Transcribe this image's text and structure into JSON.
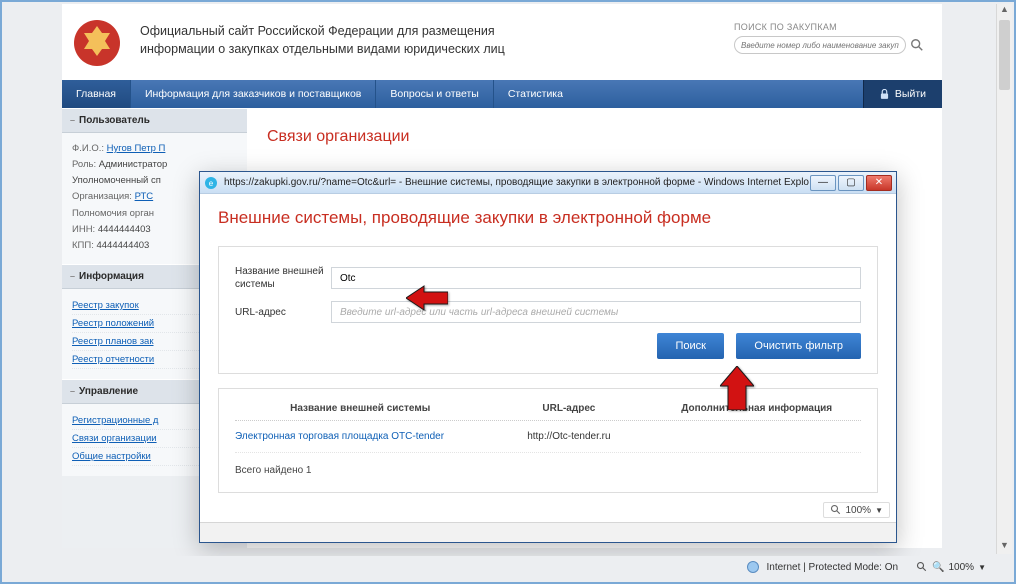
{
  "site": {
    "title_line1": "Официальный сайт Российской Федерации для размещения",
    "title_line2": "информации о закупках отдельными видами юридических лиц",
    "search_label": "ПОИСК ПО ЗАКУПКАМ",
    "search_placeholder": "Введите номер либо наименование закупки"
  },
  "nav": {
    "items": [
      "Главная",
      "Информация для заказчиков и поставщиков",
      "Вопросы и ответы",
      "Статистика"
    ],
    "login": "Выйти"
  },
  "sidebar": {
    "user_head": "Пользователь",
    "fio_label": "Ф.И.О.:",
    "fio_value": "Нугов Петр П",
    "role_label": "Роль:",
    "role_value": "Администратор Уполномоченный сп",
    "org_label": "Организация:",
    "org_value": "РТС",
    "perm_label": "Полномочия орган",
    "inn_label": "ИНН:",
    "inn_value": "4444444403",
    "kpp_label": "КПП:",
    "kpp_value": "4444444403",
    "info_head": "Информация",
    "info_links": [
      "Реестр закупок",
      "Реестр положений",
      "Реестр планов зак",
      "Реестр отчетности"
    ],
    "manage_head": "Управление",
    "manage_links": [
      "Регистрационные д",
      "Связи организации",
      "Общие настройки"
    ]
  },
  "content": {
    "heading": "Связи организации"
  },
  "modal": {
    "window_title": "https://zakupki.gov.ru/?name=Otc&url= - Внешние системы, проводящие закупки в электронной форме - Windows Internet Explo",
    "heading": "Внешние системы, проводящие закупки в электронной форме",
    "name_label": "Название внешней\nсистемы",
    "name_value": "Otc",
    "url_label": "URL-адрес",
    "url_placeholder": "Введите url-адрес или часть url-адреса внешней системы",
    "btn_search": "Поиск",
    "btn_clear": "Очистить фильтр",
    "col1": "Название внешней системы",
    "col2": "URL-адрес",
    "col3": "Дополнительная информация",
    "row_name": "Электронная торговая площадка ОТС-tender",
    "row_url": "http://Otc-tender.ru",
    "found": "Всего найдено 1",
    "zoom": "100%"
  },
  "status": {
    "mode": "Internet | Protected Mode: On",
    "zoom": "100%"
  }
}
